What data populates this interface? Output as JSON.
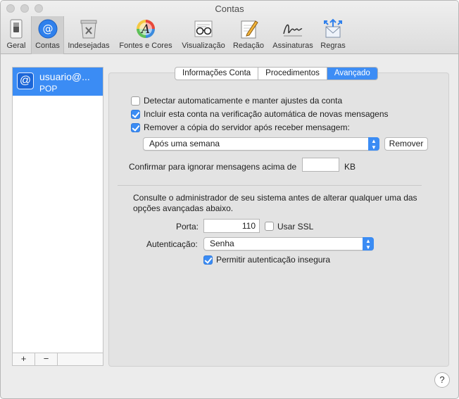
{
  "window": {
    "title": "Contas"
  },
  "toolbar": {
    "items": [
      {
        "label": "Geral",
        "icon": "switch-icon"
      },
      {
        "label": "Contas",
        "icon": "at-sign-icon",
        "active": true
      },
      {
        "label": "Indesejadas",
        "icon": "junk-trash-icon"
      },
      {
        "label": "Fontes e Cores",
        "icon": "font-color-icon"
      },
      {
        "label": "Visualização",
        "icon": "glasses-icon"
      },
      {
        "label": "Redação",
        "icon": "pencil-notepad-icon"
      },
      {
        "label": "Assinaturas",
        "icon": "signature-icon"
      },
      {
        "label": "Regras",
        "icon": "rules-envelope-icon"
      }
    ]
  },
  "sidebar": {
    "account": {
      "name": "usuario@...",
      "type": "POP"
    },
    "add_label": "+",
    "remove_label": "−"
  },
  "tabs": [
    {
      "label": "Informações Conta"
    },
    {
      "label": "Procedimentos"
    },
    {
      "label": "Avançado",
      "selected": true
    }
  ],
  "advanced": {
    "auto_detect": {
      "label": "Detectar automaticamente e manter ajustes da conta",
      "checked": false
    },
    "include_check": {
      "label": "Incluir esta conta na verificação automática de novas mensagens",
      "checked": true
    },
    "remove_copy": {
      "label": "Remover a cópia do servidor após receber mensagem:",
      "checked": true
    },
    "remove_after": {
      "value": "Após uma semana"
    },
    "remove_button": "Remover",
    "confirm_label": "Confirmar para ignorar mensagens acima de",
    "confirm_value": "",
    "confirm_unit": "KB",
    "admin_note_line1": "Consulte o administrador de seu sistema antes de alterar qualquer uma das",
    "admin_note_line2": "opções avançadas abaixo.",
    "port_label": "Porta:",
    "port_value": "110",
    "ssl": {
      "label": "Usar SSL",
      "checked": false
    },
    "auth_label": "Autenticação:",
    "auth_value": "Senha",
    "insecure": {
      "label": "Permitir autenticação insegura",
      "checked": true
    }
  },
  "help_label": "?",
  "colors": {
    "accent": "#3b8cf4"
  }
}
